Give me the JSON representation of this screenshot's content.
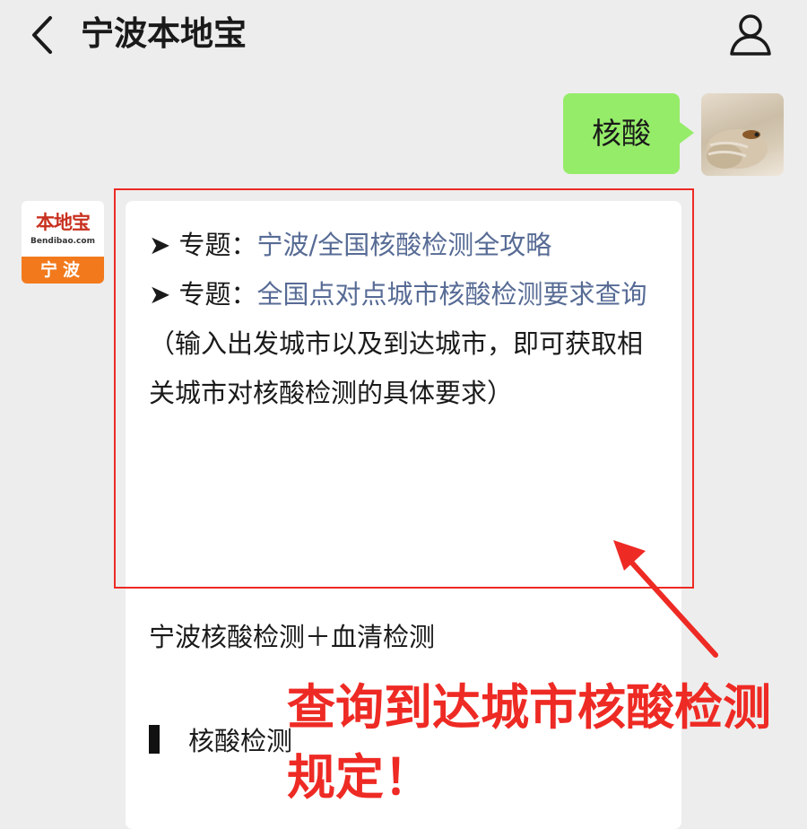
{
  "header": {
    "title": "宁波本地宝"
  },
  "chat": {
    "user_message": "核酸"
  },
  "bot_avatar": {
    "logo_text": "本地宝",
    "logo_url": "Bendibao.com",
    "city_text": "宁波"
  },
  "card": {
    "item1_prefix": "➤ 专题：",
    "item1_link": "宁波/全国核酸检测全攻略",
    "item2_prefix": "➤ 专题：",
    "item2_link": "全国点对点城市核酸检测要求查询",
    "note": "（输入出发城市以及到达城市，即可获取相关城市对核酸检测的具体要求）",
    "section_title": "宁波核酸检测＋血清检测",
    "subsection_title": "核酸检测"
  },
  "annotation": {
    "text": "查询到达城市核酸检测规定！",
    "color": "#ee2a24"
  },
  "colors": {
    "bubble_green": "#95ec69",
    "link_blue": "#576b95",
    "logo_orange": "#f27a1d",
    "logo_red": "#c8311f"
  },
  "icons": [
    "back-icon",
    "profile-icon"
  ]
}
